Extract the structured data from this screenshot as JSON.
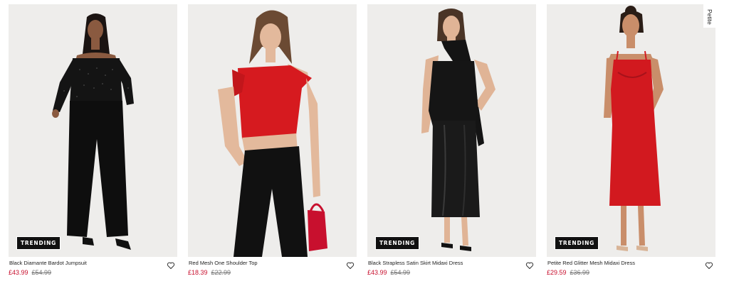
{
  "products": [
    {
      "name": "Black Diamante Bardot Jumpsuit",
      "price": "£43.99",
      "was_price": "£54.99",
      "badge": "TRENDING"
    },
    {
      "name": "Red Mesh One Shoulder Top",
      "price": "£18.39",
      "was_price": "£22.99",
      "badge": ""
    },
    {
      "name": "Black Strapless Satin Skirt Midaxi Dress",
      "price": "£43.99",
      "was_price": "£54.99",
      "badge": "TRENDING"
    },
    {
      "name": "Petite Red Glitter Mesh Midaxi Dress",
      "price": "£29.59",
      "was_price": "£36.99",
      "badge": "TRENDING",
      "tag": "Petite"
    }
  ],
  "icons": {
    "wishlist": "heart-outline-icon"
  },
  "colors": {
    "sale_price": "#c8102e",
    "was_price": "#777777",
    "badge_bg": "#111111",
    "photo_bg": "#eeedeb"
  }
}
